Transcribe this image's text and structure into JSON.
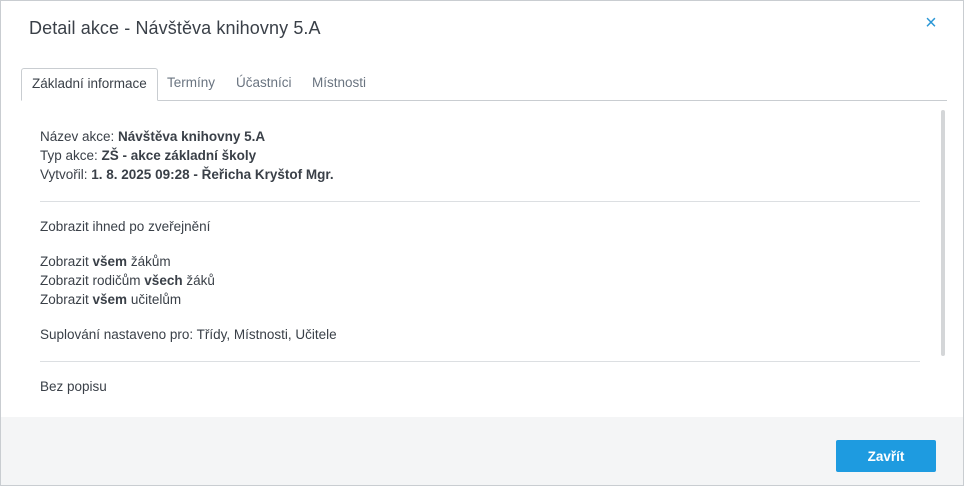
{
  "dialog": {
    "title": "Detail akce - Návštěva knihovny 5.A",
    "close_icon": "×"
  },
  "tabs": [
    {
      "label": "Základní informace",
      "active": true
    },
    {
      "label": "Termíny",
      "active": false
    },
    {
      "label": "Účastníci",
      "active": false
    },
    {
      "label": "Místnosti",
      "active": false
    }
  ],
  "info": {
    "name_label": "Název akce: ",
    "name_value": "Návštěva knihovny 5.A",
    "type_label": "Typ akce: ",
    "type_value": "ZŠ - akce základní školy",
    "created_label": "Vytvořil: ",
    "created_value": "1. 8. 2025 09:28 - Řeřicha Kryštof Mgr."
  },
  "visibility": {
    "publish": "Zobrazit ihned po zveřejnění",
    "students_pre": "Zobrazit ",
    "students_bold": "všem",
    "students_post": " žákům",
    "parents_pre": "Zobrazit rodičům ",
    "parents_bold": "všech",
    "parents_post": " žáků",
    "teachers_pre": "Zobrazit ",
    "teachers_bold": "všem",
    "teachers_post": " učitelům",
    "substitution": "Suplování nastaveno pro: Třídy, Místnosti, Učitele"
  },
  "description": "Bez popisu",
  "footer": {
    "close_button": "Zavřít"
  },
  "colors": {
    "accent": "#1e9be0",
    "close_icon": "#2a97d6"
  }
}
